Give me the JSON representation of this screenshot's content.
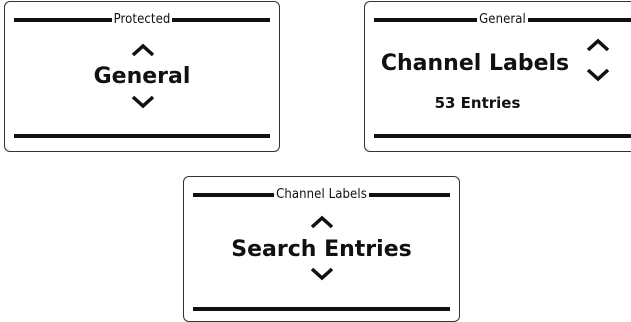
{
  "screens": [
    {
      "header": "Protected",
      "item": "General"
    },
    {
      "header": "General",
      "item": "Channel Labels",
      "subtext": "53 Entries"
    },
    {
      "header": "Channel Labels",
      "item": "Search Entries"
    }
  ],
  "icons": {
    "up": "chevron-up-icon",
    "down": "chevron-down-icon"
  },
  "colors": {
    "foreground": "#111111",
    "background": "#ffffff",
    "border": "#333333"
  }
}
